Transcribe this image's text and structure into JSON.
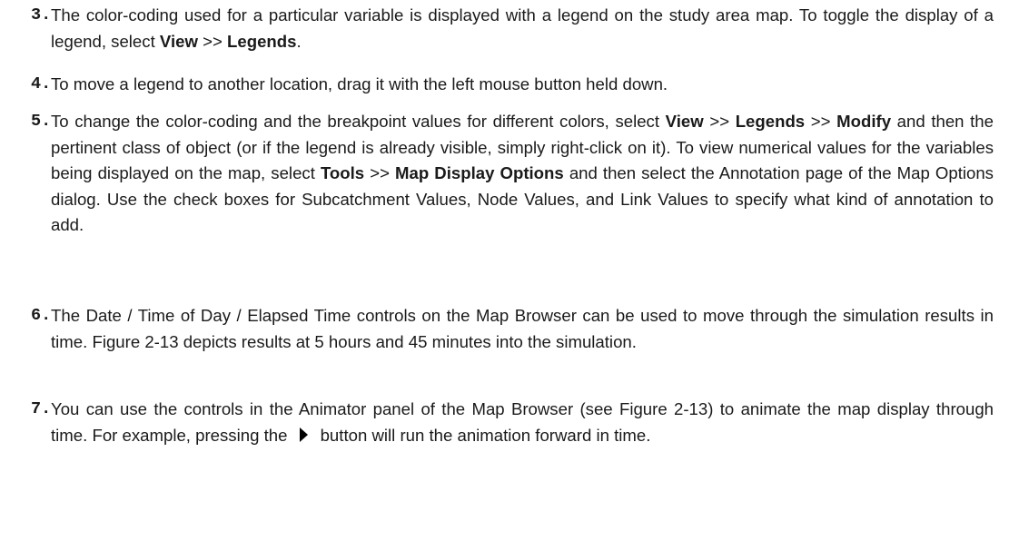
{
  "steps": [
    {
      "number": "3.",
      "parts": [
        "The color-coding used for a particular variable is displayed with a legend on the study area map. To toggle the display of a legend, select ",
        "View",
        " >> ",
        "Legends",
        "."
      ]
    },
    {
      "number": "4.",
      "parts": [
        "To move a legend to another location, drag it with the left mouse button held down."
      ]
    },
    {
      "number": "5.",
      "parts": [
        "To change the color-coding and the breakpoint values for different colors, select ",
        "View",
        " >> ",
        "Legends",
        " >> ",
        "Modify",
        " and then the pertinent class of object (or if the legend is already visible, simply right-click on it). To view numerical values for the variables being displayed on the map, select ",
        "Tools",
        " >> ",
        "Map Display Options",
        " and then select the Annotation page of the Map Options dialog. Use the check boxes for Subcatchment Values, Node Values, and Link Values to specify what kind of annotation to add."
      ]
    },
    {
      "number": "6.",
      "parts": [
        "The Date / Time of Day / Elapsed Time controls on the Map Browser can be used to move through the simulation results in time. Figure 2-13 depicts results at 5 hours and 45 minutes into the simulation."
      ]
    },
    {
      "number": "7.",
      "parts": [
        "You can use the controls in the Animator panel of the Map Browser (see Figure 2-13) to animate the map display through time. For example, pressing the ",
        "button will run the animation forward in time."
      ]
    }
  ],
  "icons": {
    "play": "play-icon"
  }
}
